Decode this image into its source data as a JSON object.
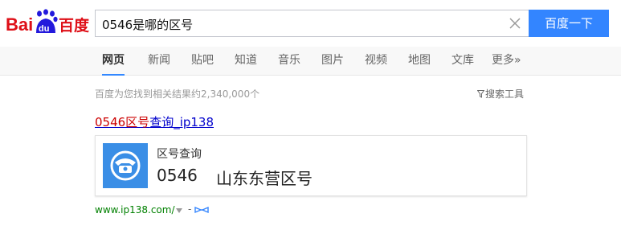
{
  "logo": {
    "text_bai": "Bai",
    "text_du": "du",
    "text_cn": "百度"
  },
  "search": {
    "query": "0546是哪的区号",
    "button_label": "百度一下"
  },
  "tabs": [
    {
      "label": "网页",
      "active": true
    },
    {
      "label": "新闻"
    },
    {
      "label": "贴吧"
    },
    {
      "label": "知道"
    },
    {
      "label": "音乐"
    },
    {
      "label": "图片"
    },
    {
      "label": "视频"
    },
    {
      "label": "地图"
    },
    {
      "label": "文库"
    },
    {
      "label": "更多»"
    }
  ],
  "results_info": {
    "count_text": "百度为您找到相关结果约2,340,000个",
    "tools_label": "搜索工具"
  },
  "result": {
    "title_highlight": "0546区号",
    "title_rest": "查询_ip138",
    "card_label": "区号查询",
    "card_code": "0546",
    "card_region": "山东东营区号",
    "url": "www.ip138.com/",
    "url_sep": "-"
  },
  "colors": {
    "brand_red": "#de0f17",
    "brand_blue": "#2319dc",
    "button_blue": "#3385ff",
    "link": "#0000cc",
    "highlight": "#cc0000",
    "url_green": "#008000",
    "card_icon_bg": "#3a8ee6"
  },
  "icons": [
    "baidu-paw-icon",
    "clear-icon",
    "funnel-icon",
    "phone-icon",
    "chevron-down-icon",
    "trust-badge-icon"
  ]
}
